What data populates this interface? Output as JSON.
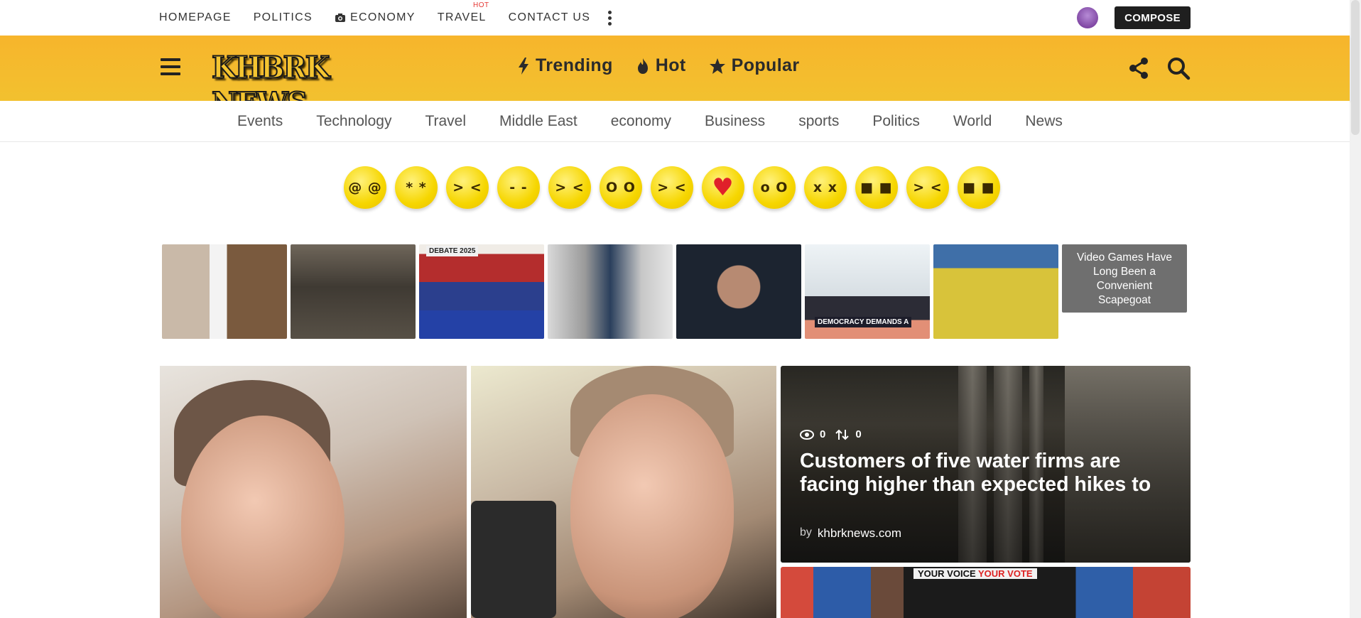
{
  "topnav": {
    "items": [
      "HOMEPAGE",
      "POLITICS",
      "ECONOMY",
      "TRAVEL",
      "CONTACT US"
    ],
    "hot_badge": "HOT",
    "compose_label": "COMPOSE"
  },
  "header": {
    "logo_text": "KHBRK NEWS",
    "nav": [
      {
        "label": "Trending",
        "icon": "lightning-icon"
      },
      {
        "label": "Hot",
        "icon": "flame-icon"
      },
      {
        "label": "Popular",
        "icon": "star-icon"
      }
    ]
  },
  "categories": [
    "Events",
    "Technology",
    "Travel",
    "Middle East",
    "economy",
    "Business",
    "sports",
    "Politics",
    "World",
    "News"
  ],
  "reactions": [
    {
      "name": "dizzy",
      "face": "@ @"
    },
    {
      "name": "starstruck",
      "face": "* *"
    },
    {
      "name": "squint",
      "face": "> <"
    },
    {
      "name": "unamused",
      "face": "- -"
    },
    {
      "name": "tongue",
      "face": "> <"
    },
    {
      "name": "nerd",
      "face": "O O"
    },
    {
      "name": "laugh-cry",
      "face": "> <"
    },
    {
      "name": "love",
      "face": "♥"
    },
    {
      "name": "crazy",
      "face": "o O"
    },
    {
      "name": "sick",
      "face": "x x"
    },
    {
      "name": "cool",
      "face": "■ ■"
    },
    {
      "name": "laughing",
      "face": "> <"
    },
    {
      "name": "cool-smirk",
      "face": "■ ■"
    }
  ],
  "strip": {
    "thumb_labels": [
      "",
      "",
      "DEBATE 2025",
      "",
      "",
      "DEMOCRACY DEMANDS A",
      ""
    ],
    "caption": "Video Games Have Long Been a Convenient Scapegoat"
  },
  "feature_side": {
    "views": "0",
    "shares": "0",
    "title": "Customers of five water firms are facing higher than expected hikes to",
    "by_label": "by",
    "author": "khbrknews.com"
  },
  "feature_side2": {
    "banner_a": "YOUR VOICE",
    "banner_b": "YOUR VOTE"
  },
  "colors": {
    "header_yellow": "#f2c12f",
    "compose_bg": "#1f1f1f",
    "hot_red": "#e53935"
  }
}
